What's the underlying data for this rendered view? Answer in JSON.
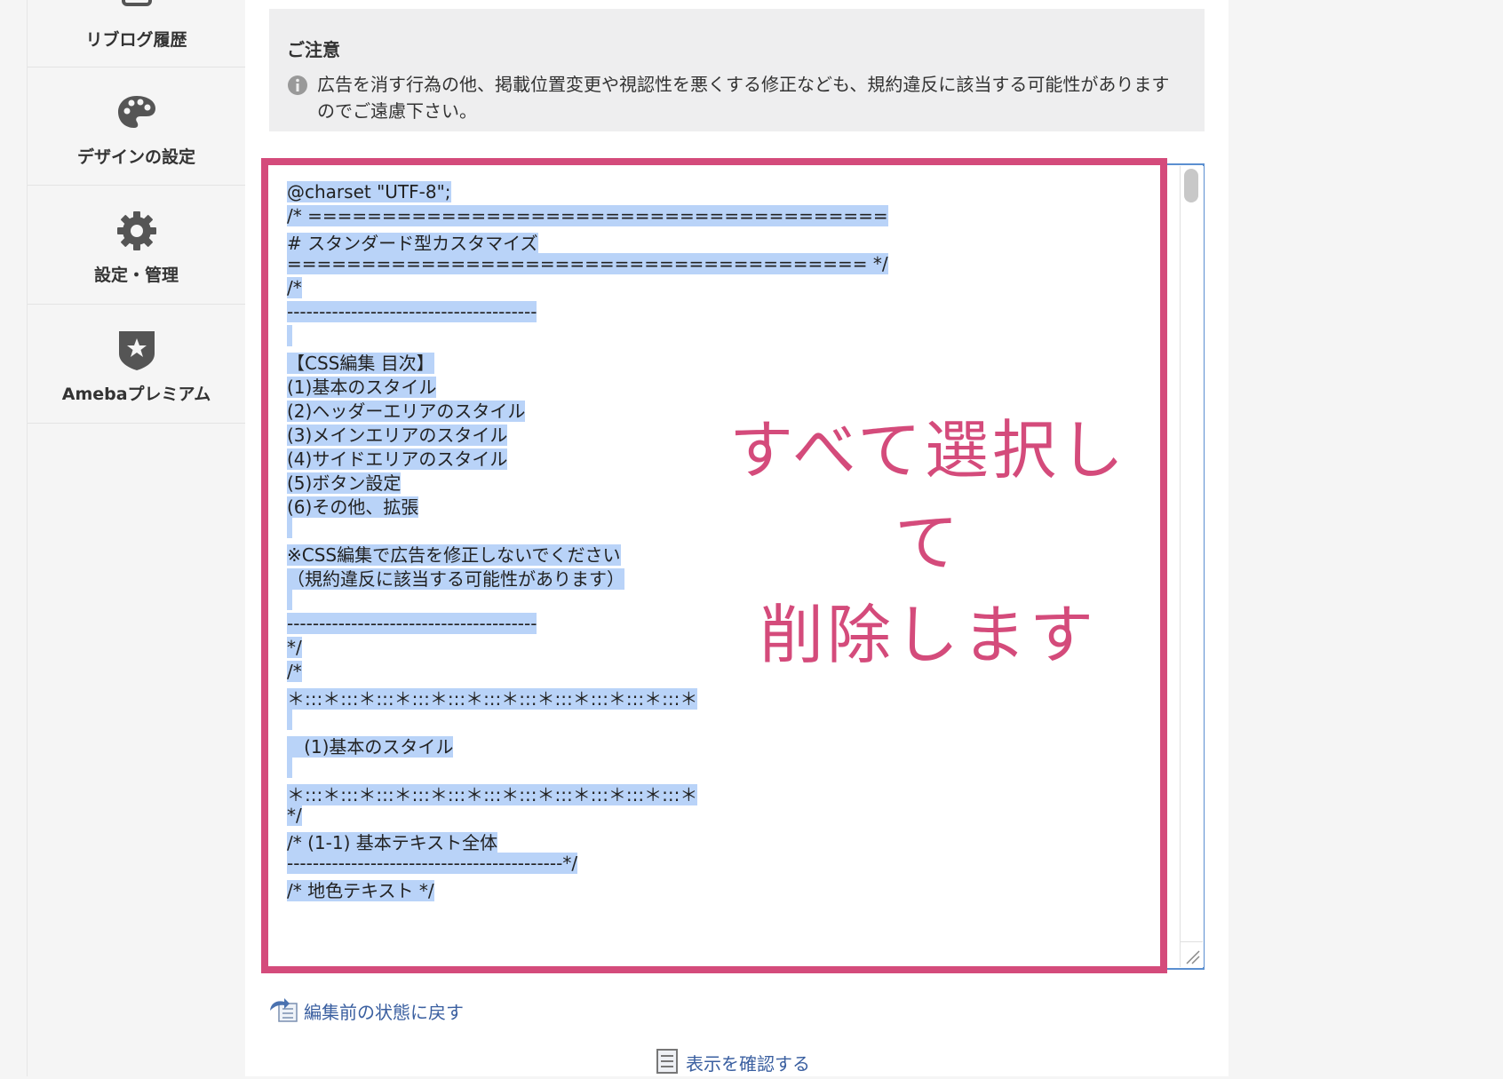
{
  "sidebar": {
    "items": [
      {
        "label": "リブログ履歴",
        "icon": "reblog-icon"
      },
      {
        "label": "デザインの設定",
        "icon": "palette-icon"
      },
      {
        "label": "設定・管理",
        "icon": "gear-icon"
      },
      {
        "label": "Amebaプレミアム",
        "icon": "premium-shield-icon"
      }
    ]
  },
  "notice": {
    "title": "ご注意",
    "text": "広告を消す行為の他、掲載位置変更や視認性を悪くする修正なども、規約違反に該当する可能性がありますのでご遠慮下さい。"
  },
  "editor": {
    "lines": [
      "@charset \"UTF-8\";",
      "/* =======================================",
      "# スタンダード型カスタマイズ",
      "======================================= */",
      "/*",
      "---------------------------------------",
      "",
      "【CSS編集 目次】",
      "(1)基本のスタイル",
      "(2)ヘッダーエリアのスタイル",
      "(3)メインエリアのスタイル",
      "(4)サイドエリアのスタイル",
      "(5)ボタン設定",
      "(6)その他、拡張",
      "",
      "※CSS編集で広告を修正しないでください",
      "（規約違反に該当する可能性があります）",
      "",
      "---------------------------------------",
      "*/",
      "/*",
      "＊:::＊:::＊:::＊:::＊:::＊:::＊:::＊:::＊:::＊:::＊:::＊",
      "",
      "   (1)基本のスタイル",
      "",
      "＊:::＊:::＊:::＊:::＊:::＊:::＊:::＊:::＊:::＊:::＊:::＊",
      "*/",
      "/* (1-1) 基本テキスト全体",
      "-------------------------------------------*/",
      "/* 地色テキスト */"
    ]
  },
  "annotation": {
    "line1": "すべて選択して",
    "line2": "削除します"
  },
  "links": {
    "revert": "編集前の状態に戻す",
    "preview": "表示を確認する"
  },
  "colors": {
    "highlight": "#d44b7b",
    "selection": "#b9d3f8",
    "link": "#3a5fa0"
  }
}
